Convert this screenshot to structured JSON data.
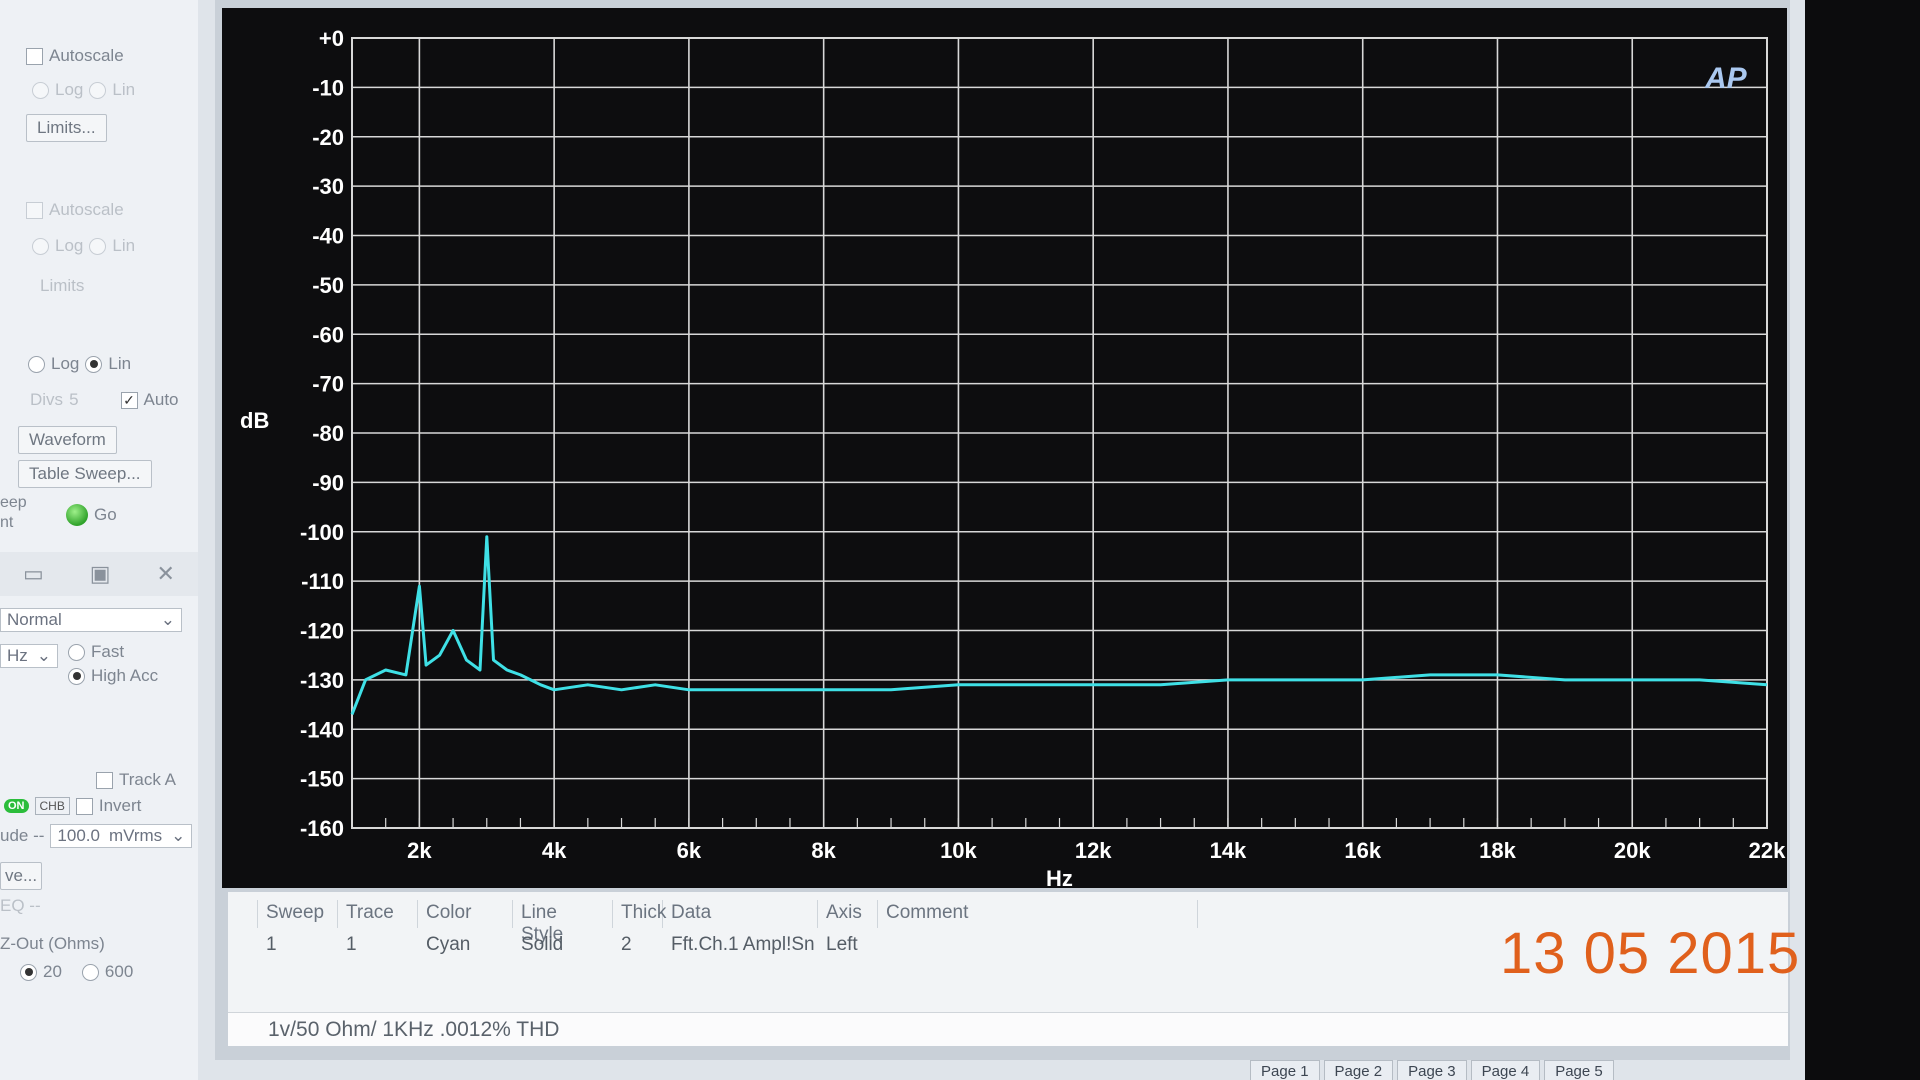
{
  "left_panel": {
    "autoscale_1": "Autoscale",
    "log_1": "Log",
    "lin_1": "Lin",
    "limits_1": "Limits...",
    "autoscale_2": "Autoscale",
    "log_2": "Log",
    "lin_2": "Lin",
    "limits_2": "Limits",
    "log_3": "Log",
    "lin_3": "Lin",
    "divs_label": "Divs",
    "divs_value": "5",
    "auto_label": "Auto",
    "waveform": "Waveform",
    "table_sweep": "Table Sweep...",
    "sweep_label": "eep",
    "sweep_label2": "nt",
    "go": "Go",
    "mode": "Normal",
    "unit_hz": "Hz",
    "fast": "Fast",
    "high_acc": "High Acc",
    "track_a": "Track A",
    "on_badge": "ON",
    "chb": "CHB",
    "invert": "Invert",
    "amplitude_label": "ude --",
    "amplitude_value": "100.0",
    "amplitude_unit": "mVrms",
    "save_label": "ve...",
    "eq_label": "EQ --",
    "zout_label": "Z-Out (Ohms)",
    "zout_20": "20",
    "zout_600": "600"
  },
  "trace_table": {
    "headers": [
      "Sweep",
      "Trace",
      "Color",
      "Line Style",
      "Thick",
      "Data",
      "Axis",
      "Comment"
    ],
    "row": {
      "sweep": "1",
      "trace": "1",
      "color": "Cyan",
      "line_style": "Solid",
      "thick": "2",
      "data": "Fft.Ch.1 Ampl!Sn",
      "axis": "Left"
    }
  },
  "comment_text": "1v/50 Ohm/  1KHz  .0012% THD",
  "date_stamp": "13 05 2015",
  "page_tabs": [
    "Page 1",
    "Page 2",
    "Page 3",
    "Page 4",
    "Page 5"
  ],
  "colors": {
    "trace": "#3fe0e6",
    "grid": "#d8d8d8",
    "plot_bg": "#0d0d0f",
    "date": "#e0601c"
  },
  "logo": "AP",
  "chart_data": {
    "type": "line",
    "ylabel": "dB",
    "xlabel": "Hz",
    "ylim": [
      -160,
      0
    ],
    "xlim": [
      1000,
      22000
    ],
    "y_ticks": [
      "+0",
      "-10",
      "-20",
      "-30",
      "-40",
      "-50",
      "-60",
      "-70",
      "-80",
      "-90",
      "-100",
      "-110",
      "-120",
      "-130",
      "-140",
      "-150",
      "-160"
    ],
    "x_ticks": [
      "2k",
      "4k",
      "6k",
      "8k",
      "10k",
      "12k",
      "14k",
      "16k",
      "18k",
      "20k",
      "22k"
    ],
    "x_tick_values": [
      2000,
      4000,
      6000,
      8000,
      10000,
      12000,
      14000,
      16000,
      18000,
      20000,
      22000
    ],
    "grid": true,
    "series": [
      {
        "color": "Cyan",
        "x": [
          1000,
          1200,
          1500,
          1800,
          2000,
          2100,
          2300,
          2500,
          2700,
          2900,
          3000,
          3100,
          3300,
          3500,
          3800,
          4000,
          4500,
          5000,
          5500,
          6000,
          7000,
          8000,
          9000,
          10000,
          11000,
          12000,
          13000,
          14000,
          15000,
          16000,
          17000,
          18000,
          19000,
          20000,
          21000,
          22000
        ],
        "y": [
          -137,
          -130,
          -128,
          -129,
          -111,
          -127,
          -125,
          -120,
          -126,
          -128,
          -101,
          -126,
          -128,
          -129,
          -131,
          -132,
          -131,
          -132,
          -131,
          -132,
          -132,
          -132,
          -132,
          -131,
          -131,
          -131,
          -131,
          -130,
          -130,
          -130,
          -129,
          -129,
          -130,
          -130,
          -130,
          -131
        ]
      }
    ]
  }
}
